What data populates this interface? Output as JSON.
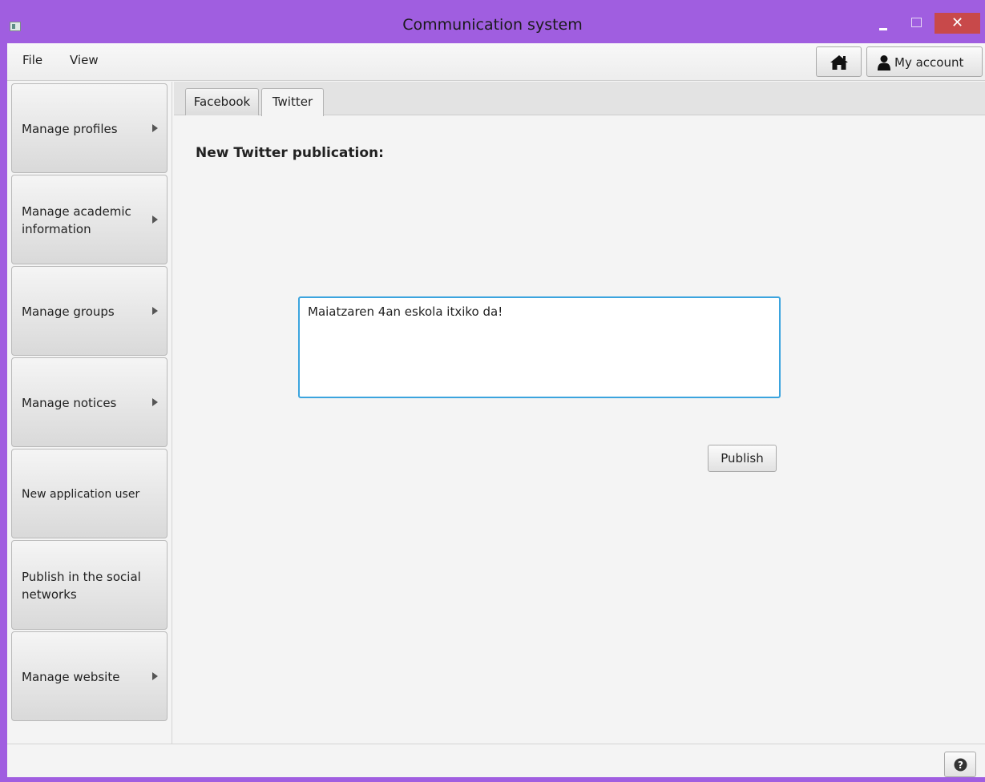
{
  "window": {
    "title": "Communication system",
    "close_glyph": "✕"
  },
  "menu": {
    "file": "File",
    "view": "View"
  },
  "toolbar": {
    "home_icon": "home-icon",
    "account_label": "My account",
    "account_icon": "user-icon"
  },
  "sidebar": {
    "items": [
      {
        "label": "Manage profiles",
        "has_submenu": true
      },
      {
        "label": "Manage academic information",
        "has_submenu": true
      },
      {
        "label": "Manage groups",
        "has_submenu": true
      },
      {
        "label": "Manage notices",
        "has_submenu": true
      },
      {
        "label": "New application user",
        "has_submenu": false
      },
      {
        "label": "Publish in the social networks",
        "has_submenu": false
      },
      {
        "label": "Manage website",
        "has_submenu": true
      }
    ]
  },
  "tabs": {
    "items": [
      {
        "label": "Facebook",
        "selected": false
      },
      {
        "label": "Twitter",
        "selected": true
      }
    ]
  },
  "main": {
    "heading": "New Twitter publication:",
    "message_value": "Maiatzaren 4an eskola itxiko da!",
    "publish_label": "Publish"
  },
  "statusbar": {
    "help_icon": "help-icon"
  },
  "colors": {
    "title_bar": "#a05ee0",
    "close_button": "#c8494a",
    "focus_border": "#3ba4de"
  }
}
